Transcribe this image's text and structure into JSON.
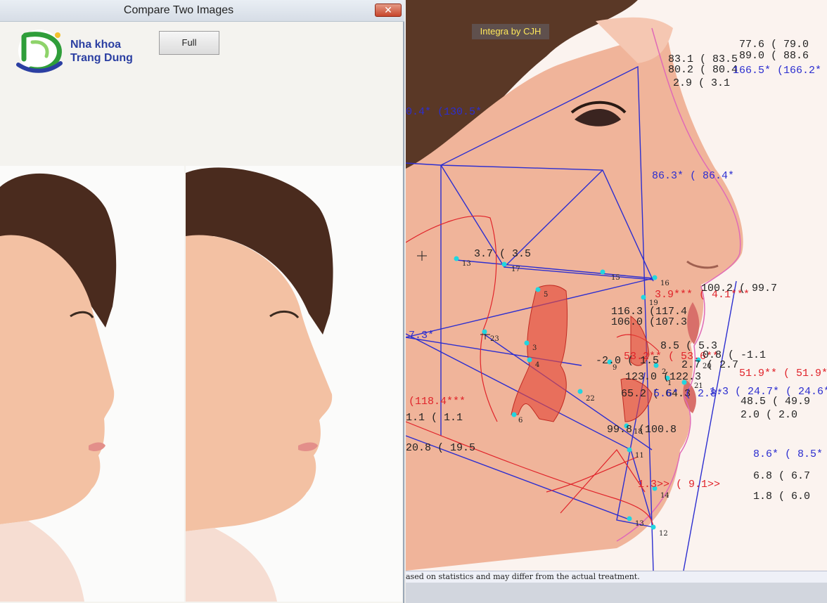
{
  "dialog": {
    "title": "Compare Two Images",
    "close_glyph": "✕",
    "full_button": "Full",
    "logo": {
      "line1": "Nha khoa",
      "line2": "Trang Dung"
    }
  },
  "ceph": {
    "watermark": "Integra by CJH",
    "status_text": "ased on statistics and may differ from the actual treatment.",
    "measurements": [
      {
        "id": "m01",
        "text": "77.6 ( 79.0",
        "color": "black"
      },
      {
        "id": "m02",
        "text": "89.0 ( 88.6",
        "color": "black"
      },
      {
        "id": "m03",
        "text": "83.1 ( 83.5",
        "color": "black"
      },
      {
        "id": "m04",
        "text": "80.2 ( 80.4",
        "color": "black"
      },
      {
        "id": "m05",
        "text": "166.5* (166.2*",
        "color": "blue"
      },
      {
        "id": "m06",
        "text": "2.9 ( 3.1",
        "color": "black"
      },
      {
        "id": "m07",
        "text": "0.4* (130.5*",
        "color": "blue"
      },
      {
        "id": "m08",
        "text": "86.3* ( 86.4*",
        "color": "blue"
      },
      {
        "id": "m09",
        "text": "3.7 ( 3.5",
        "color": "black"
      },
      {
        "id": "m10",
        "text": "3.9*** ( 4.1***",
        "color": "red"
      },
      {
        "id": "m11",
        "text": "100.2 ( 99.7",
        "color": "black"
      },
      {
        "id": "m12",
        "text": "116.3 (117.4",
        "color": "black"
      },
      {
        "id": "m13",
        "text": "106.0 (107.3",
        "color": "black"
      },
      {
        "id": "m14",
        "text": "7.3*",
        "color": "blue"
      },
      {
        "id": "m15",
        "text": "8.5 ( 5.3",
        "color": "black"
      },
      {
        "id": "m16",
        "text": "53.2** ( 53.6**",
        "color": "red"
      },
      {
        "id": "m17",
        "text": "0.8 ( -1.1",
        "color": "black"
      },
      {
        "id": "m18",
        "text": "-2.0 ( 1.5",
        "color": "black"
      },
      {
        "id": "m19",
        "text": "2.7 ( 2.7",
        "color": "black"
      },
      {
        "id": "m20",
        "text": "51.9** ( 51.9*",
        "color": "red"
      },
      {
        "id": "m21",
        "text": "123.0 (122.3",
        "color": "black"
      },
      {
        "id": "m22",
        "text": "65.2 ( 64.3",
        "color": "black"
      },
      {
        "id": "m23",
        "text": "5.6* ( 2.8*",
        "color": "blue"
      },
      {
        "id": "m24",
        "text": "1.3 ( 24.7* ( 24.6*",
        "color": "blue"
      },
      {
        "id": "m25",
        "text": "48.5 ( 49.9",
        "color": "black"
      },
      {
        "id": "m26",
        "text": "(118.4***",
        "color": "red"
      },
      {
        "id": "m27",
        "text": "2.0 ( 2.0",
        "color": "black"
      },
      {
        "id": "m28",
        "text": "1.1 ( 1.1",
        "color": "black"
      },
      {
        "id": "m29",
        "text": "99.8 (100.8",
        "color": "black"
      },
      {
        "id": "m30",
        "text": "20.8 ( 19.5",
        "color": "black"
      },
      {
        "id": "m31",
        "text": "8.6* ( 8.5*",
        "color": "blue"
      },
      {
        "id": "m32",
        "text": "6.8 ( 6.7",
        "color": "black"
      },
      {
        "id": "m33",
        "text": "1.3>> ( 9.1>>",
        "color": "red"
      },
      {
        "id": "m34",
        "text": "1.8 ( 6.0",
        "color": "black"
      }
    ],
    "landmark_labels": [
      "13",
      "17",
      "15",
      "16",
      "19",
      "5",
      "23",
      "3",
      "4",
      "9",
      "2",
      "20",
      "1",
      "21",
      "22",
      "6",
      "18",
      "11",
      "14",
      "13",
      "12"
    ]
  }
}
